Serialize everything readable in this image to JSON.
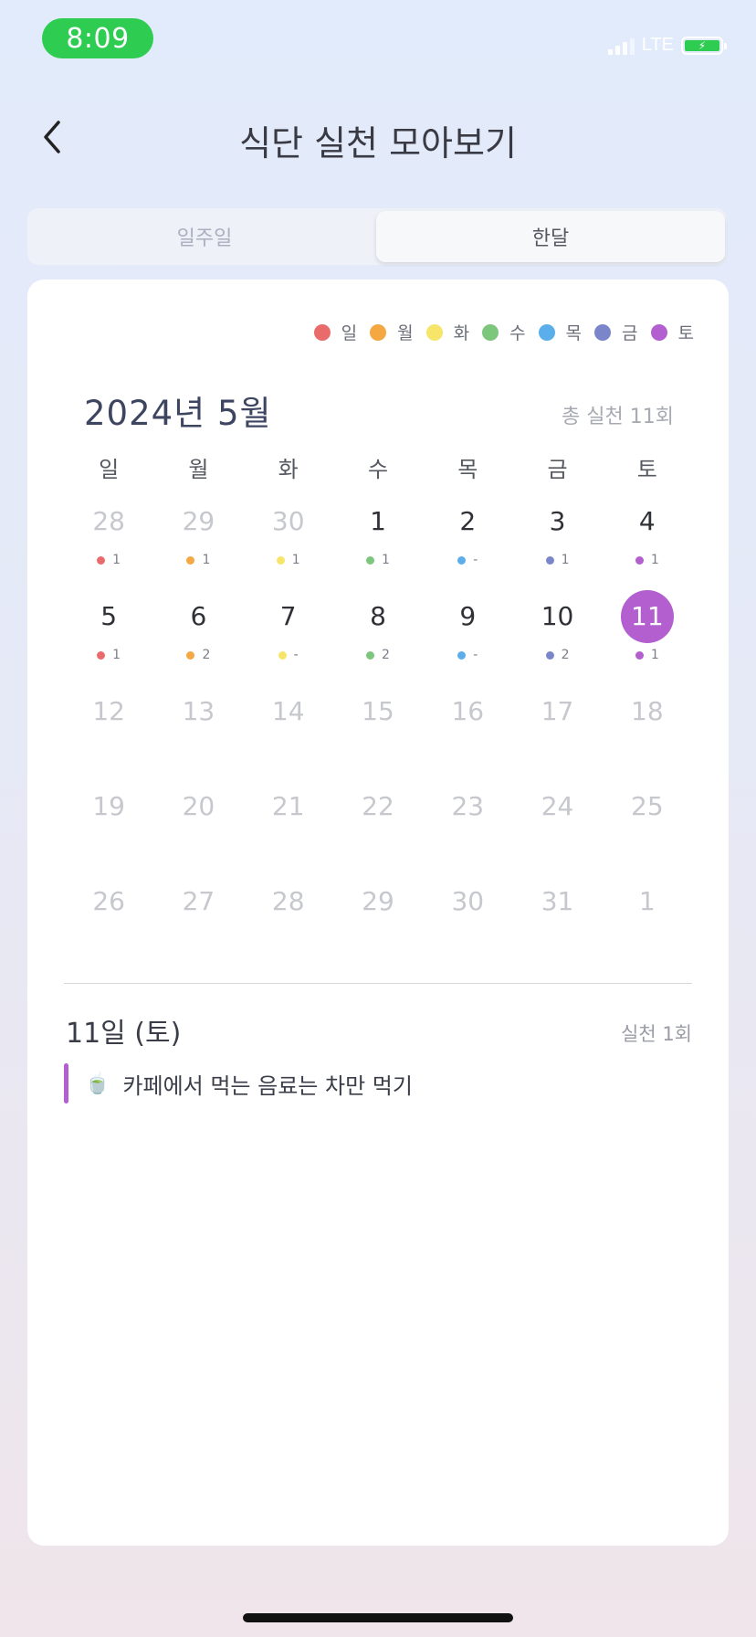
{
  "status_bar": {
    "time": "8:09",
    "network": "LTE"
  },
  "header": {
    "title": "식단 실천 모아보기"
  },
  "segments": {
    "week": "일주일",
    "month": "한달",
    "selected": "month"
  },
  "legend": [
    {
      "label": "일",
      "color": "#e96b6b"
    },
    {
      "label": "월",
      "color": "#f5a742"
    },
    {
      "label": "화",
      "color": "#f7e56a"
    },
    {
      "label": "수",
      "color": "#7dc77d"
    },
    {
      "label": "목",
      "color": "#5aaeea"
    },
    {
      "label": "금",
      "color": "#7a86c9"
    },
    {
      "label": "토",
      "color": "#b45fcf"
    }
  ],
  "calendar": {
    "month_title": "2024년 5월",
    "total": "총 실천 11회",
    "weekdays": [
      "일",
      "월",
      "화",
      "수",
      "목",
      "금",
      "토"
    ],
    "days": [
      {
        "day": "28",
        "muted": true,
        "count": "1"
      },
      {
        "day": "29",
        "muted": true,
        "count": "1"
      },
      {
        "day": "30",
        "muted": true,
        "count": "1"
      },
      {
        "day": "1",
        "muted": false,
        "count": "1"
      },
      {
        "day": "2",
        "muted": false,
        "count": "-"
      },
      {
        "day": "3",
        "muted": false,
        "count": "1"
      },
      {
        "day": "4",
        "muted": false,
        "count": "1"
      },
      {
        "day": "5",
        "muted": false,
        "count": "1"
      },
      {
        "day": "6",
        "muted": false,
        "count": "2"
      },
      {
        "day": "7",
        "muted": false,
        "count": "-"
      },
      {
        "day": "8",
        "muted": false,
        "count": "2"
      },
      {
        "day": "9",
        "muted": false,
        "count": "-"
      },
      {
        "day": "10",
        "muted": false,
        "count": "2"
      },
      {
        "day": "11",
        "muted": false,
        "count": "1",
        "selected": true
      },
      {
        "day": "12",
        "muted": true
      },
      {
        "day": "13",
        "muted": true
      },
      {
        "day": "14",
        "muted": true
      },
      {
        "day": "15",
        "muted": true
      },
      {
        "day": "16",
        "muted": true
      },
      {
        "day": "17",
        "muted": true
      },
      {
        "day": "18",
        "muted": true
      },
      {
        "day": "19",
        "muted": true
      },
      {
        "day": "20",
        "muted": true
      },
      {
        "day": "21",
        "muted": true
      },
      {
        "day": "22",
        "muted": true
      },
      {
        "day": "23",
        "muted": true
      },
      {
        "day": "24",
        "muted": true
      },
      {
        "day": "25",
        "muted": true
      },
      {
        "day": "26",
        "muted": true
      },
      {
        "day": "27",
        "muted": true
      },
      {
        "day": "28",
        "muted": true
      },
      {
        "day": "29",
        "muted": true
      },
      {
        "day": "30",
        "muted": true
      },
      {
        "day": "31",
        "muted": true
      },
      {
        "day": "1",
        "muted": true
      }
    ]
  },
  "selected_day": {
    "date": "11일 (토)",
    "count": "실천 1회",
    "entries": [
      {
        "icon": "🍵",
        "text": "카페에서 먹는 음료는 차만 먹기"
      }
    ]
  }
}
